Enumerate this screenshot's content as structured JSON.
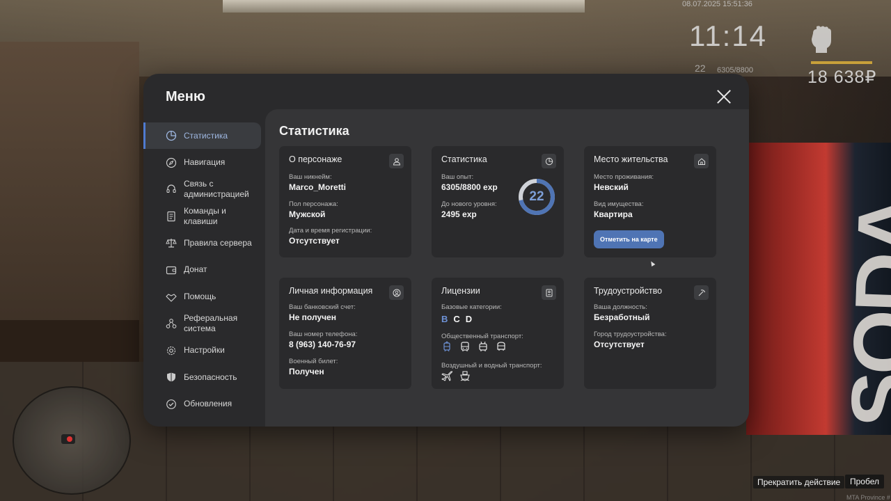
{
  "hud": {
    "datetime": "08.07.2025 15:51:36",
    "time": "11:14",
    "level": "22",
    "exp": "6305/8800",
    "money": "18 638₽"
  },
  "hints": {
    "cancel": "Прекратить действие",
    "key": "Пробел",
    "watermark": "MTA Province #"
  },
  "menu": {
    "title": "Меню",
    "sidebar": [
      {
        "label": "Статистика",
        "icon": "pie-chart-icon",
        "active": true
      },
      {
        "label": "Навигация",
        "icon": "compass-icon"
      },
      {
        "label": "Связь с администрацией",
        "icon": "headset-icon"
      },
      {
        "label": "Команды и клавиши",
        "icon": "document-icon"
      },
      {
        "label": "Правила сервера",
        "icon": "scales-icon"
      },
      {
        "label": "Донат",
        "icon": "wallet-icon"
      },
      {
        "label": "Помощь",
        "icon": "handshake-icon"
      },
      {
        "label": "Реферальная система",
        "icon": "network-icon"
      },
      {
        "label": "Настройки",
        "icon": "gear-icon"
      },
      {
        "label": "Безопасность",
        "icon": "shield-icon"
      },
      {
        "label": "Обновления",
        "icon": "update-icon"
      }
    ]
  },
  "content": {
    "title": "Статистика",
    "character": {
      "title": "О персонаже",
      "nick_label": "Ваш никнейм:",
      "nick": "Marco_Moretti",
      "gender_label": "Пол персонажа:",
      "gender": "Мужской",
      "reg_label": "Дата и время регистрации:",
      "reg": "Отсутствует"
    },
    "stats": {
      "title": "Статистика",
      "exp_label": "Ваш опыт:",
      "exp": "6305/8800 exp",
      "next_label": "До нового уровня:",
      "next": "2495 exp",
      "level": "22",
      "progress": 0.7165,
      "accent": "#4f74b4"
    },
    "residence": {
      "title": "Место жительства",
      "place_label": "Место проживания:",
      "place": "Невский",
      "type_label": "Вид имущества:",
      "type": "Квартира",
      "button": "Отметить на карте"
    },
    "personal": {
      "title": "Личная информация",
      "bank_label": "Ваш банковский счет:",
      "bank": "Не получен",
      "phone_label": "Ваш номер телефона:",
      "phone": "8 (963) 140-76-97",
      "military_label": "Военный билет:",
      "military": "Получен"
    },
    "licenses": {
      "title": "Лицензии",
      "base_label": "Базовые категории:",
      "categories": [
        "B",
        "C",
        "D"
      ],
      "public_label": "Общественный транспорт:",
      "public_icons": [
        "tram-icon",
        "bus-icon",
        "trolleybus-icon",
        "minibus-icon"
      ],
      "air_label": "Воздушный и водный транспорт:",
      "air_icons": [
        "plane-icon",
        "boat-icon"
      ]
    },
    "employment": {
      "title": "Трудоустройство",
      "position_label": "Ваша должность:",
      "position": "Безработный",
      "city_label": "Город трудоустройства:",
      "city": "Отсутствует"
    }
  }
}
